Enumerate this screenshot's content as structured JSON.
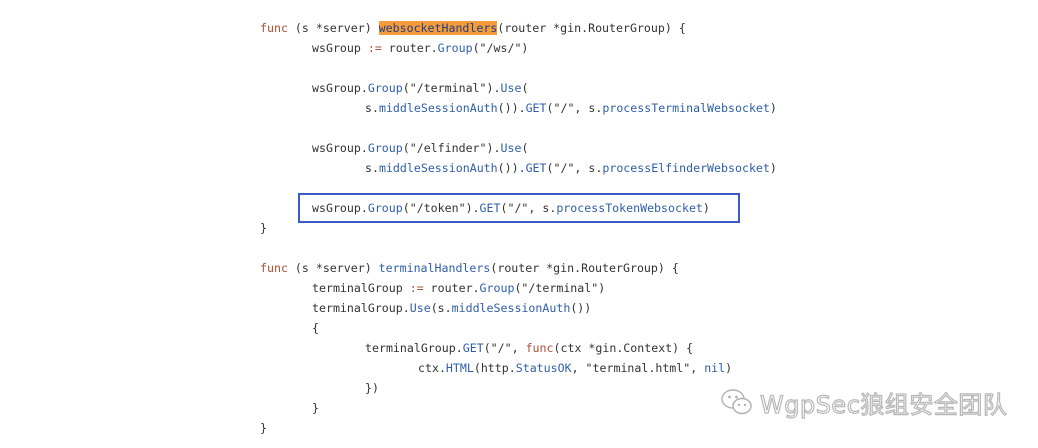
{
  "code": {
    "l1": {
      "kw": "func",
      "recv": " (s *server) ",
      "fname": "websocketHandlers",
      "rest": "(router *gin.RouterGroup) {"
    },
    "l2": {
      "pre": "wsGroup ",
      "op": ":=",
      "mid": " router.",
      "call": "Group",
      "arg": "(\"/ws/\")"
    },
    "l3": {
      "pre": "wsGroup.",
      "call": "Group",
      "arg": "(\"/terminal\").",
      "call2": "Use",
      "post": "("
    },
    "l4": {
      "pre": "s.",
      "call": "middleSessionAuth",
      "mid": "()).",
      "call2": "GET",
      "arg": "(\"/\", s.",
      "call3": "processTerminalWebsocket",
      "post": ")"
    },
    "l5": {
      "pre": "wsGroup.",
      "call": "Group",
      "arg": "(\"/elfinder\").",
      "call2": "Use",
      "post": "("
    },
    "l6": {
      "pre": "s.",
      "call": "middleSessionAuth",
      "mid": "()).",
      "call2": "GET",
      "arg": "(\"/\", s.",
      "call3": "processElfinderWebsocket",
      "post": ")"
    },
    "l7": {
      "pre": "wsGroup.",
      "call": "Group",
      "arg": "(\"/token\").",
      "call2": "GET",
      "arg2": "(\"/\", s.",
      "call3": "processTokenWebsocket",
      "post": ")"
    },
    "l8": "}",
    "l9": {
      "kw": "func",
      "recv": " (s *server) ",
      "fname": "terminalHandlers",
      "rest": "(router *gin.RouterGroup) {"
    },
    "l10": {
      "pre": "terminalGroup ",
      "op": ":=",
      "mid": " router.",
      "call": "Group",
      "arg": "(\"/terminal\")"
    },
    "l11": {
      "pre": "terminalGroup.",
      "call": "Use",
      "mid": "(s.",
      "call2": "middleSessionAuth",
      "post": "())"
    },
    "l12": "{",
    "l13": {
      "pre": "terminalGroup.",
      "call": "GET",
      "arg": "(\"/\", ",
      "kw": "func",
      "post": "(ctx *gin.Context) {"
    },
    "l14": {
      "pre": "ctx.",
      "call": "HTML",
      "mid": "(http.",
      "call2": "StatusOK",
      "arg": ", \"terminal.html\", ",
      "kw": "nil",
      "post": ")"
    },
    "l15": "})",
    "l16": "}",
    "l17": "}"
  },
  "watermark": {
    "text": "WgpSec狼组安全团队",
    "icon": "wechat-icon"
  },
  "colors": {
    "highlight": "#f59b3a",
    "box": "#3a5ac6",
    "keyword": "#b04f36",
    "method": "#2f5fa8"
  }
}
